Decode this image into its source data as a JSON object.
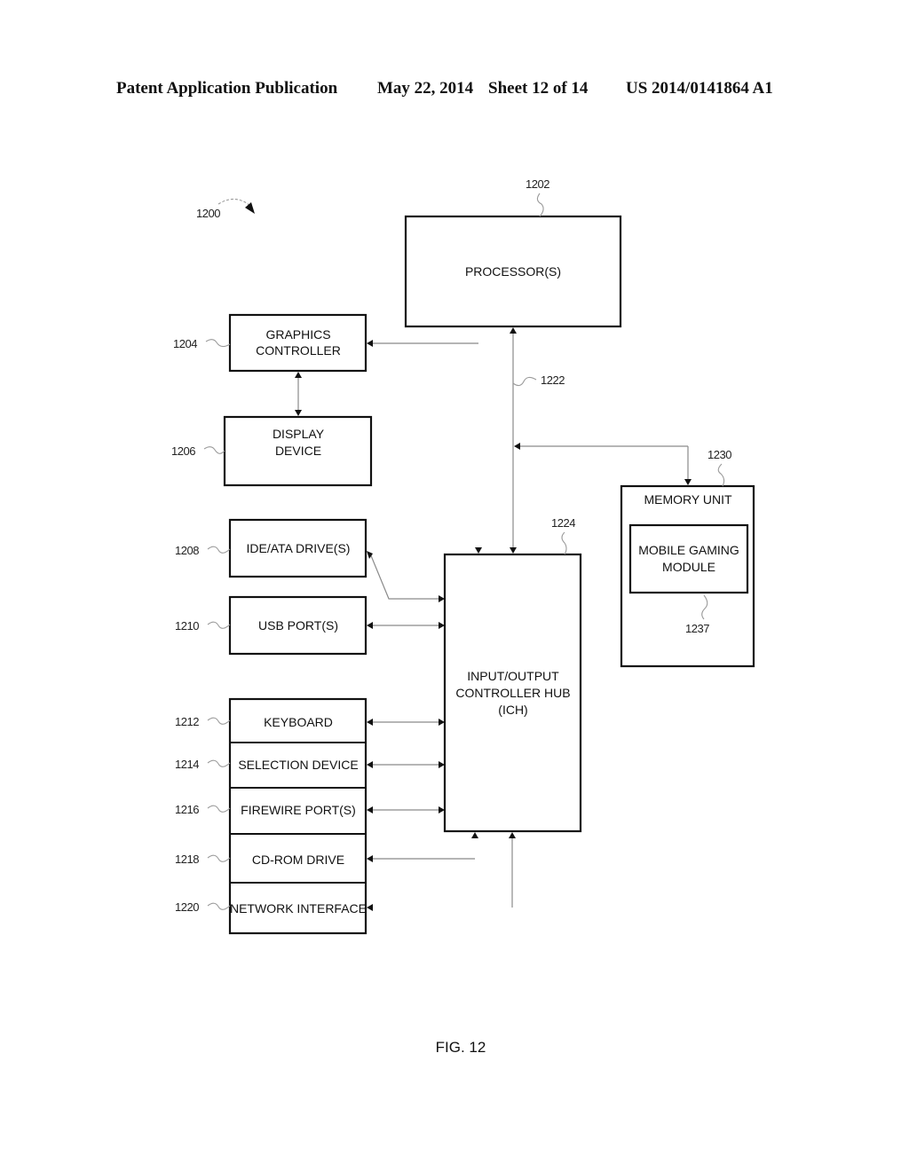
{
  "header": {
    "publication": "Patent Application Publication",
    "date": "May 22, 2014",
    "sheet": "Sheet 12 of 14",
    "number": "US 2014/0141864 A1"
  },
  "diagram": {
    "system_ref": "1200",
    "blocks": {
      "processor": {
        "ref": "1202",
        "lines": [
          "PROCESSOR(S)"
        ]
      },
      "graphics": {
        "ref": "1204",
        "lines": [
          "GRAPHICS",
          "CONTROLLER"
        ]
      },
      "display": {
        "ref": "1206",
        "lines": [
          "DISPLAY",
          "DEVICE"
        ]
      },
      "ide": {
        "ref": "1208",
        "lines": [
          "IDE/ATA DRIVE(S)"
        ]
      },
      "usb": {
        "ref": "1210",
        "lines": [
          "USB PORT(S)"
        ]
      },
      "keyboard": {
        "ref": "1212",
        "lines": [
          "KEYBOARD"
        ]
      },
      "selection": {
        "ref": "1214",
        "lines": [
          "SELECTION DEVICE"
        ]
      },
      "firewire": {
        "ref": "1216",
        "lines": [
          "FIREWIRE PORT(S)"
        ]
      },
      "cdrom": {
        "ref": "1218",
        "lines": [
          "CD-ROM DRIVE"
        ]
      },
      "network": {
        "ref": "1220",
        "lines": [
          "NETWORK INTERFACE"
        ]
      },
      "ich": {
        "ref": "1224",
        "lines": [
          "INPUT/OUTPUT",
          "CONTROLLER HUB",
          "(ICH)"
        ]
      },
      "memory": {
        "ref": "1230",
        "lines": [
          "MEMORY UNIT"
        ]
      },
      "gaming": {
        "ref": "1237",
        "lines": [
          "MOBILE GAMING",
          "MODULE"
        ]
      }
    },
    "bus_ref": "1222"
  },
  "figure_label": "FIG. 12"
}
